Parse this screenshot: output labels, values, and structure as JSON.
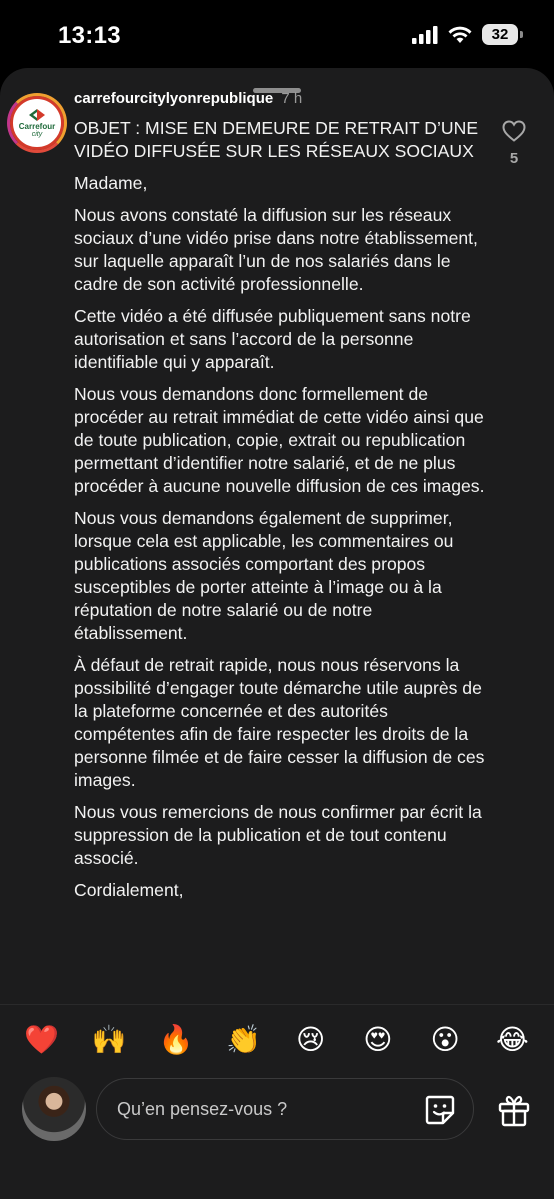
{
  "status_bar": {
    "time": "13:13",
    "battery": "32"
  },
  "comment": {
    "username": "carrefourcitylyonrepublique",
    "time_ago": "7 h",
    "avatar": {
      "brand": "Carrefour",
      "sub": "city"
    },
    "like_count": "5",
    "paragraphs": [
      "OBJET : MISE EN DEMEURE DE RETRAIT D’UNE VIDÉO DIFFUSÉE SUR LES RÉSEAUX SOCIAUX",
      "Madame,",
      "Nous avons constaté la diffusion sur les réseaux sociaux d’une vidéo prise dans notre établissement, sur laquelle apparaît l’un de nos salariés dans le cadre de son activité professionnelle.",
      "Cette vidéo a été diffusée publiquement sans notre autorisation et sans l’accord de la personne identifiable qui y apparaît.",
      "Nous vous demandons donc formellement de procéder au retrait immédiat de cette vidéo ainsi que de toute publication, copie, extrait ou republication permettant d’identifier notre salarié, et de ne plus procéder à aucune nouvelle diffusion de ces images.",
      "Nous vous demandons également de supprimer, lorsque cela est applicable, les commentaires ou publications associés comportant des propos susceptibles de porter atteinte à l’image ou à la réputation de notre salarié ou de notre établissement.",
      "À défaut de retrait rapide, nous nous réservons la possibilité d’engager toute démarche utile auprès de la plateforme concernée et des autorités compétentes afin de faire respecter les droits de la personne filmée et de faire cesser la diffusion de ces images.",
      "Nous vous remercions de nous confirmer par écrit la suppression de la publication et de tout contenu associé.",
      "Cordialement,"
    ]
  },
  "emoji_bar": [
    "❤️",
    "🙌",
    "🔥",
    "👏",
    "😢",
    "😍",
    "😮",
    "😂"
  ],
  "composer": {
    "placeholder": "Qu’en pensez-vous ?"
  },
  "colors": {
    "sheet_bg": "#1c1c1d",
    "page_bg": "#000000",
    "avatar_ring": "#d33a2a"
  }
}
